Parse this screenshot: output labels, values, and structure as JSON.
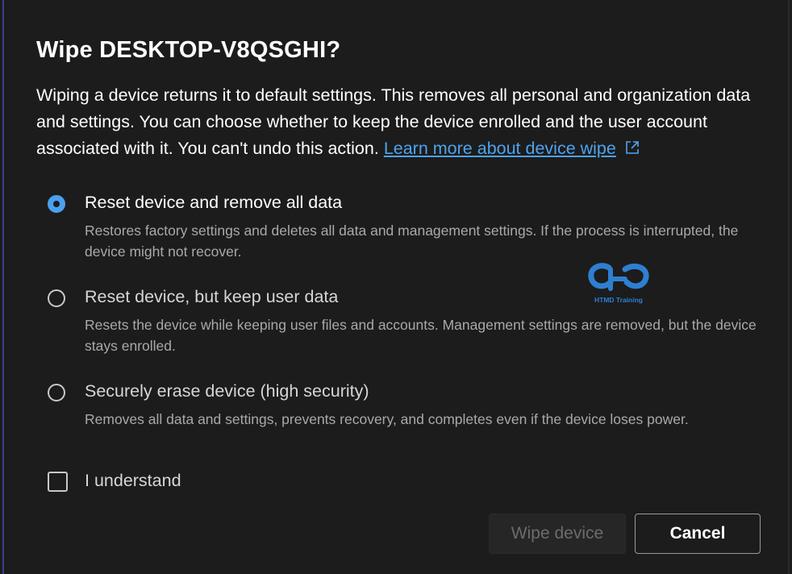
{
  "dialog": {
    "title": "Wipe DESKTOP-V8QSGHI?",
    "description": "Wiping a device returns it to default settings. This removes all personal and organization data and settings. You can choose whether to keep the device enrolled and the user account associated with it. You can't undo this action.",
    "learn_more_link": "Learn more about device wipe",
    "external_link_icon": "external-link-icon",
    "accent_color": "#4aa0f0"
  },
  "options": [
    {
      "label": "Reset device and remove all data",
      "description": "Restores factory settings and deletes all data and management settings. If the process is interrupted, the device might not recover.",
      "selected": true
    },
    {
      "label": "Reset device, but keep user data",
      "description": "Resets the device while keeping user files and accounts. Management settings are removed, but the device stays enrolled.",
      "selected": false
    },
    {
      "label": "Securely erase device (high security)",
      "description": "Removes all data and settings, prevents recovery, and completes even if the device loses power.",
      "selected": false
    }
  ],
  "confirm": {
    "label": "I understand",
    "checked": false
  },
  "buttons": {
    "wipe": "Wipe device",
    "wipe_enabled": false,
    "cancel": "Cancel"
  },
  "watermark": {
    "text": "HTMD Training"
  }
}
